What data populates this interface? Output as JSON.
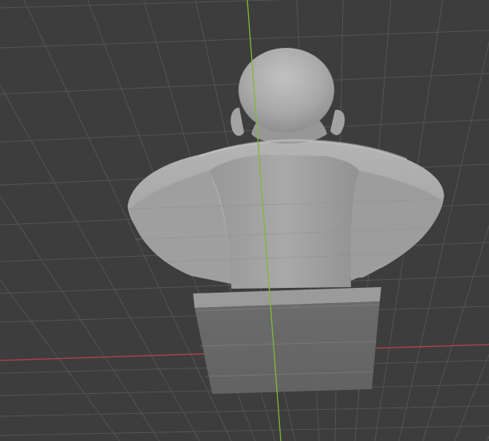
{
  "viewport": {
    "background_color": "#3d3d3d",
    "grid_color": "#545454",
    "x_axis_color": "#b5414a",
    "y_axis_color": "#7eb93a",
    "model_color": "#aaaaaa",
    "model_shadow_color": "#7e7e7e",
    "pedestal_front_color": "#686868",
    "pedestal_top_color": "#9b9b9b"
  },
  "scene": {
    "object": "bust-model",
    "view": "perspective-from-below"
  }
}
